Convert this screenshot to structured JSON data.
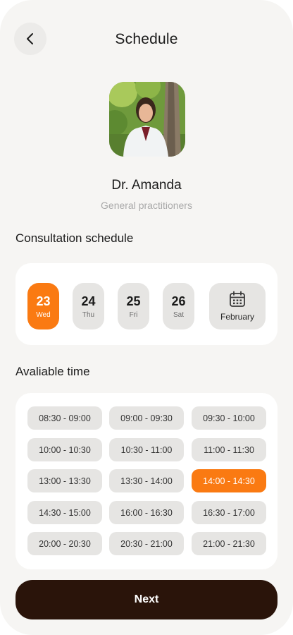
{
  "header": {
    "title": "Schedule"
  },
  "doctor": {
    "name": "Dr. Amanda",
    "role": "General practitioners"
  },
  "schedule": {
    "title": "Consultation schedule",
    "days": [
      {
        "num": "23",
        "weekday": "Wed",
        "selected": true
      },
      {
        "num": "24",
        "weekday": "Thu",
        "selected": false
      },
      {
        "num": "25",
        "weekday": "Fri",
        "selected": false
      },
      {
        "num": "26",
        "weekday": "Sat",
        "selected": false
      }
    ],
    "month": "February"
  },
  "times": {
    "title": "Avaliable time",
    "slots": [
      "08:30 - 09:00",
      "09:00 - 09:30",
      "09:30 - 10:00",
      "10:00 - 10:30",
      "10:30 - 11:00",
      "11:00 - 11:30",
      "13:00 - 13:30",
      "13:30 - 14:00",
      "14:00 - 14:30",
      "14:30 - 15:00",
      "16:00 - 16:30",
      "16:30 - 17:00",
      "20:00 - 20:30",
      "20:30 - 21:00",
      "21:00 - 21:30"
    ],
    "selected_slot": "14:00 - 14:30"
  },
  "footer": {
    "next_label": "Next"
  },
  "colors": {
    "accent": "#fa7a12",
    "primary_button": "#2a140a",
    "background": "#f6f5f3"
  },
  "icons": {
    "back": "chevron-left-icon",
    "calendar": "calendar-icon"
  }
}
